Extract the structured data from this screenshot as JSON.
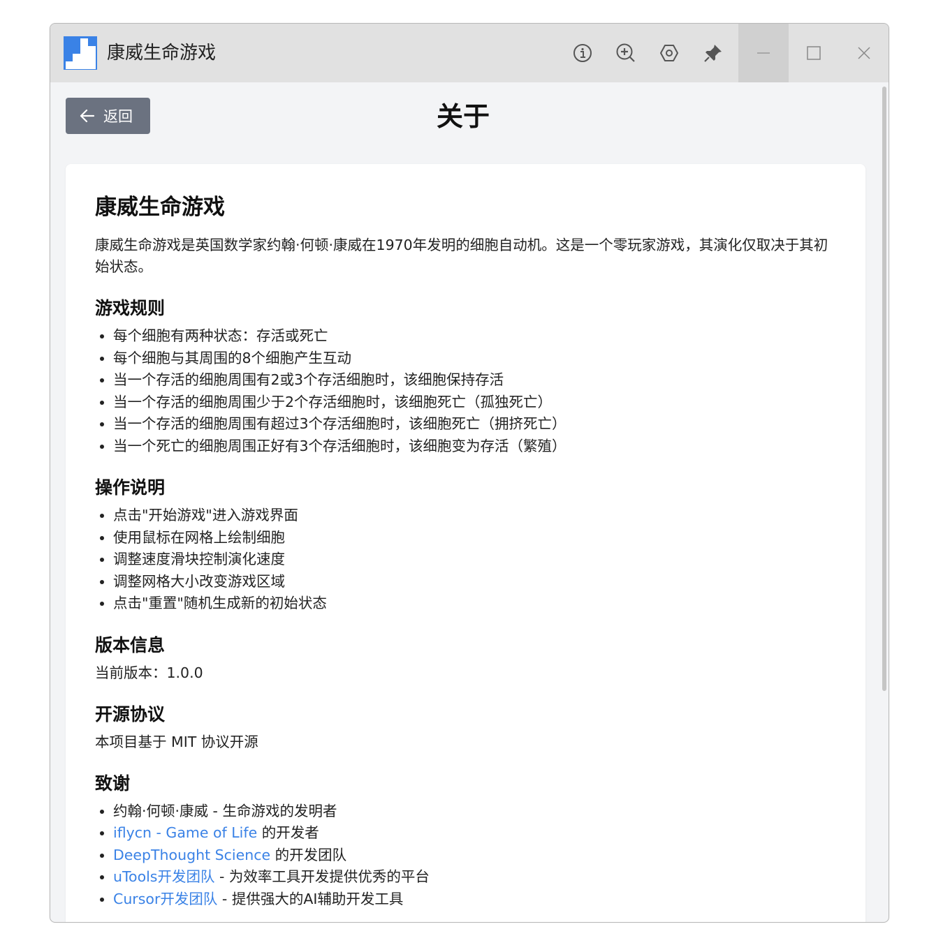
{
  "app": {
    "title": "康威生命游戏"
  },
  "titlebar_icons": [
    "info-icon",
    "zoom-in-icon",
    "settings-icon",
    "pin-icon",
    "minimize-icon",
    "maximize-icon",
    "close-icon"
  ],
  "header": {
    "back_label": "返回",
    "page_title": "关于"
  },
  "about": {
    "title": "康威生命游戏",
    "intro": "康威生命游戏是英国数学家约翰·何顿·康威在1970年发明的细胞自动机。这是一个零玩家游戏，其演化仅取决于其初始状态。",
    "rules": {
      "heading": "游戏规则",
      "items": [
        "每个细胞有两种状态：存活或死亡",
        "每个细胞与其周围的8个细胞产生互动",
        "当一个存活的细胞周围有2或3个存活细胞时，该细胞保持存活",
        "当一个存活的细胞周围少于2个存活细胞时，该细胞死亡（孤独死亡）",
        "当一个存活的细胞周围有超过3个存活细胞时，该细胞死亡（拥挤死亡）",
        "当一个死亡的细胞周围正好有3个存活细胞时，该细胞变为存活（繁殖）"
      ]
    },
    "usage": {
      "heading": "操作说明",
      "items": [
        "点击\"开始游戏\"进入游戏界面",
        "使用鼠标在网格上绘制细胞",
        "调整速度滑块控制演化速度",
        "调整网格大小改变游戏区域",
        "点击\"重置\"随机生成新的初始状态"
      ]
    },
    "version": {
      "heading": "版本信息",
      "text": "当前版本：1.0.0"
    },
    "license": {
      "heading": "开源协议",
      "text": "本项目基于 MIT 协议开源"
    },
    "thanks": {
      "heading": "致谢",
      "item1": "约翰·何顿·康威 - 生命游戏的发明者",
      "item2_link": "iflycn - Game of Life",
      "item2_text": " 的开发者",
      "item3_link": "DeepThought Science",
      "item3_text": " 的开发团队",
      "item4_link": "uTools开发团队",
      "item4_text": " - 为效率工具开发提供优秀的平台",
      "item5_link": "Cursor开发团队",
      "item5_text": " - 提供强大的AI辅助开发工具"
    }
  },
  "colors": {
    "accent": "#3a82e6",
    "back_button": "#6b7280",
    "titlebar": "#e1e1e1",
    "background": "#f3f4f6"
  }
}
